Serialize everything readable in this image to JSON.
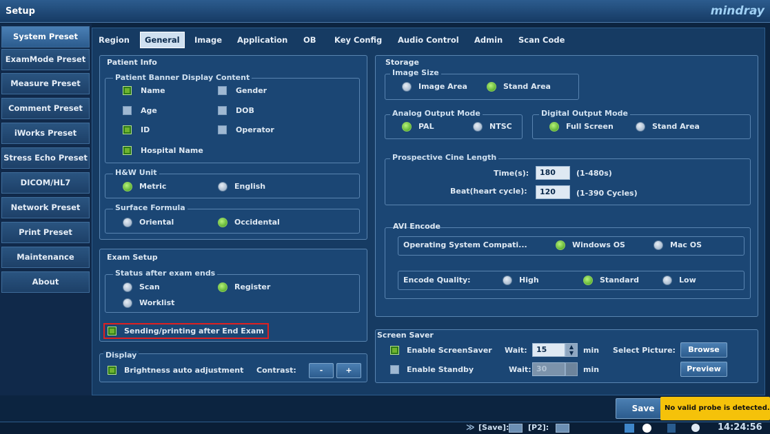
{
  "window": {
    "title": "Setup",
    "brand": "mindray"
  },
  "sidebar": {
    "items": [
      {
        "label": "System Preset"
      },
      {
        "label": "ExamMode Preset"
      },
      {
        "label": "Measure Preset"
      },
      {
        "label": "Comment Preset"
      },
      {
        "label": "iWorks Preset"
      },
      {
        "label": "Stress Echo Preset"
      },
      {
        "label": "DICOM/HL7"
      },
      {
        "label": "Network Preset"
      },
      {
        "label": "Print Preset"
      },
      {
        "label": "Maintenance"
      },
      {
        "label": "About"
      }
    ]
  },
  "tabs": [
    "Region",
    "General",
    "Image",
    "Application",
    "OB",
    "Key Config",
    "Audio Control",
    "Admin",
    "Scan Code"
  ],
  "patient_info": {
    "title": "Patient Info",
    "banner": {
      "title": "Patient Banner Display Content",
      "name": "Name",
      "gender": "Gender",
      "age": "Age",
      "dob": "DOB",
      "id": "ID",
      "operator": "Operator",
      "hospital": "Hospital Name"
    },
    "hw": {
      "title": "H&W Unit",
      "metric": "Metric",
      "english": "English"
    },
    "surface": {
      "title": "Surface Formula",
      "oriental": "Oriental",
      "occidental": "Occidental"
    }
  },
  "exam_setup": {
    "title": "Exam Setup",
    "status_title": "Status after exam ends",
    "scan": "Scan",
    "register": "Register",
    "worklist": "Worklist",
    "sending": "Sending/printing after End Exam"
  },
  "display": {
    "title": "Display",
    "brightness": "Brightness auto adjustment",
    "contrast": "Contrast:",
    "minus": "-",
    "plus": "+"
  },
  "storage": {
    "title": "Storage",
    "image_size": {
      "title": "Image Size",
      "image_area": "Image Area",
      "stand_area": "Stand Area"
    },
    "analog": {
      "title": "Analog Output Mode",
      "pal": "PAL",
      "ntsc": "NTSC"
    },
    "digital": {
      "title": "Digital Output Mode",
      "full": "Full Screen",
      "stand": "Stand Area"
    },
    "cine": {
      "title": "Prospective Cine Length",
      "time_label": "Time(s):",
      "time_value": "180",
      "time_range": "(1-480s)",
      "beat_label": "Beat(heart cycle):",
      "beat_value": "120",
      "beat_range": "(1-390 Cycles)"
    },
    "avi": {
      "title": "AVI Encode",
      "os_label": "Operating System Compati...",
      "windows": "Windows OS",
      "mac": "Mac OS",
      "quality_label": "Encode Quality:",
      "high": "High",
      "standard": "Standard",
      "low": "Low"
    }
  },
  "screensaver": {
    "title": "Screen Saver",
    "enable": "Enable ScreenSaver",
    "wait": "Wait:",
    "wait_value": "15",
    "min": "min",
    "select_picture": "Select Picture:",
    "browse": "Browse",
    "standby": "Enable Standby",
    "standby_wait": "Wait:",
    "standby_value": "30",
    "standby_min": "min",
    "preview": "Preview"
  },
  "footer": {
    "save": "Save",
    "toast": "No valid probe is detected.",
    "status": "[Save]:",
    "p2": "[P2]:",
    "time": "14:24:56"
  }
}
